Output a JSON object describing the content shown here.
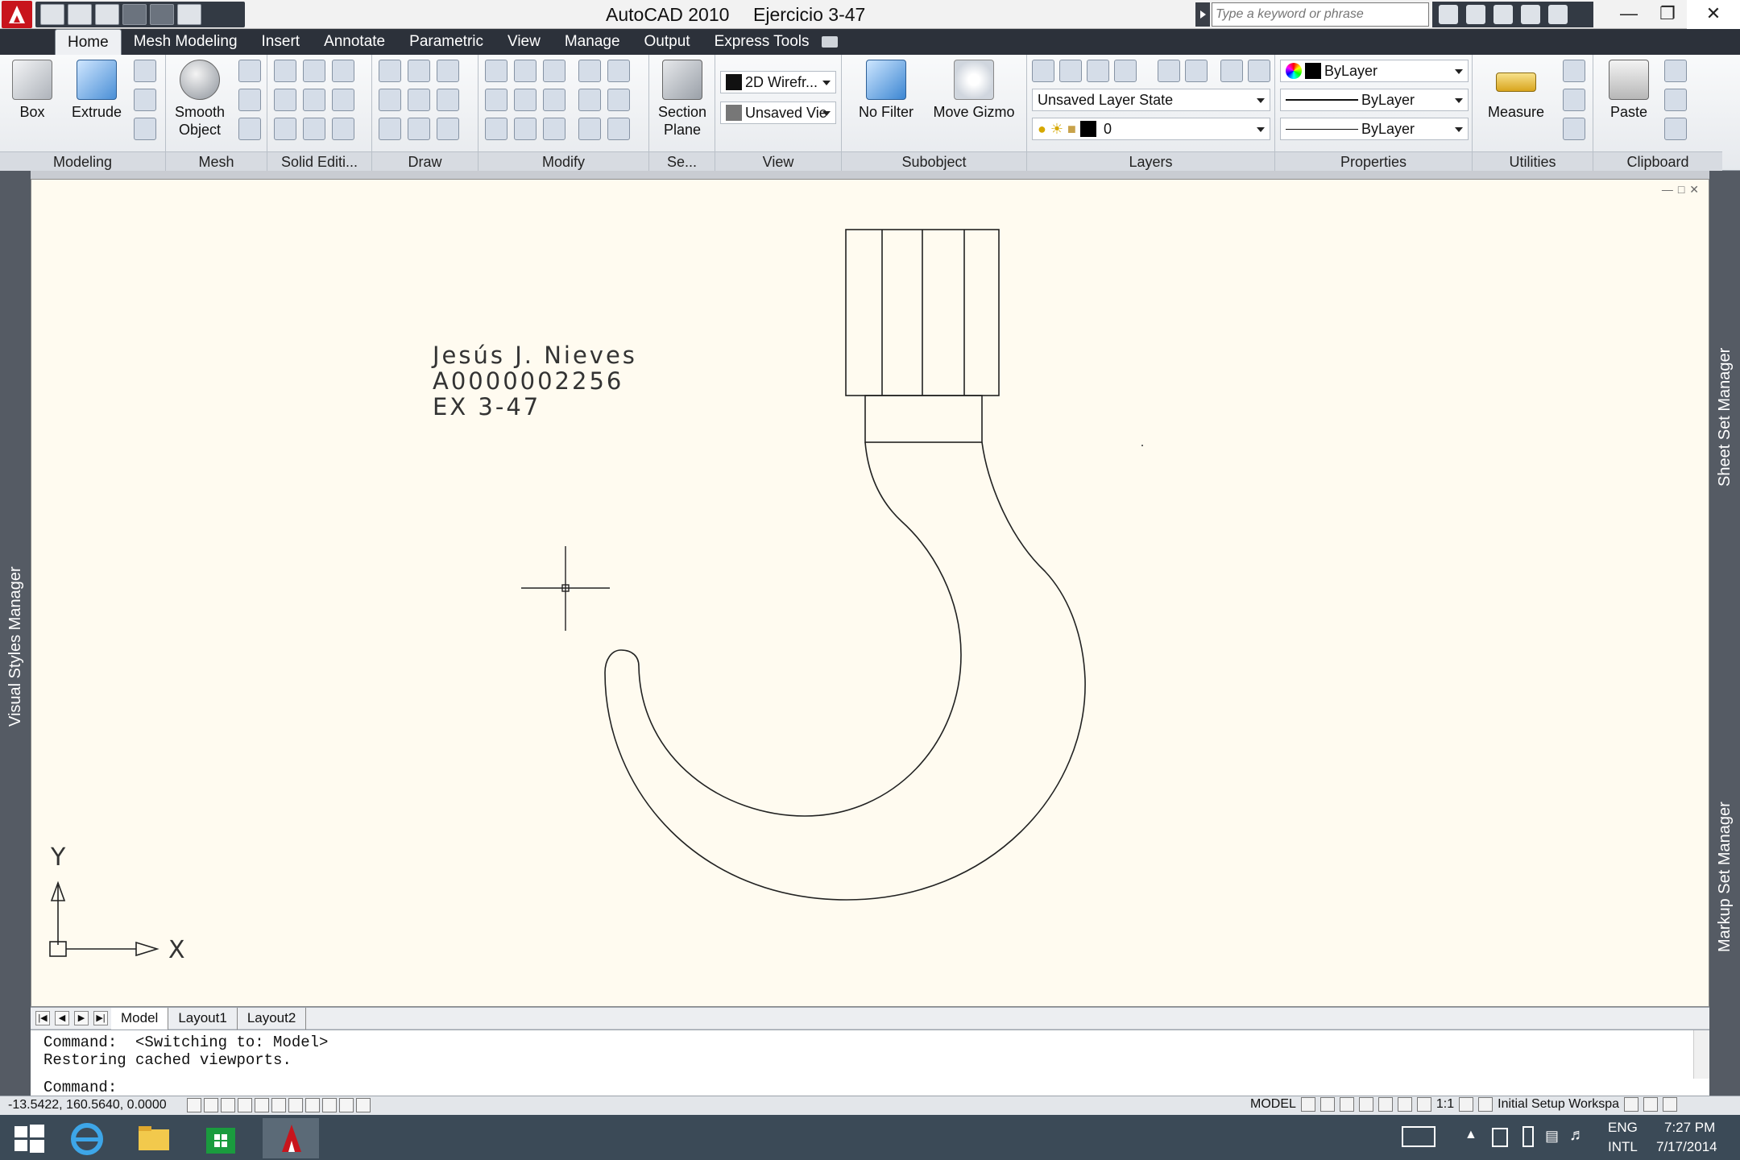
{
  "window": {
    "app_title": "AutoCAD 2010",
    "file_title": "Ejercicio 3-47",
    "search_placeholder": "Type a keyword or phrase"
  },
  "tabs": [
    "Home",
    "Mesh Modeling",
    "Insert",
    "Annotate",
    "Parametric",
    "View",
    "Manage",
    "Output",
    "Express Tools"
  ],
  "active_tab": "Home",
  "ribbon": {
    "modeling": {
      "title": "Modeling",
      "box": "Box",
      "extrude": "Extrude"
    },
    "mesh": {
      "title": "Mesh",
      "smooth_line1": "Smooth",
      "smooth_line2": "Object"
    },
    "solid_editing": {
      "title": "Solid Editi..."
    },
    "draw": {
      "title": "Draw"
    },
    "modify": {
      "title": "Modify"
    },
    "section": {
      "title": "Se...",
      "btn_line1": "Section",
      "btn_line2": "Plane"
    },
    "view": {
      "title": "View",
      "visual_style": "2D Wirefr...",
      "saved_view": "Unsaved Vie"
    },
    "subobject": {
      "title": "Subobject",
      "no_filter": "No Filter",
      "move_gizmo": "Move Gizmo"
    },
    "layers": {
      "title": "Layers",
      "layer_state": "Unsaved Layer State",
      "current_layer": "0"
    },
    "properties": {
      "title": "Properties",
      "color": "ByLayer",
      "lineweight": "ByLayer",
      "linetype": "ByLayer"
    },
    "utilities": {
      "title": "Utilities",
      "measure": "Measure"
    },
    "clipboard": {
      "title": "Clipboard",
      "paste": "Paste"
    }
  },
  "palettes": {
    "left": "Visual Styles Manager",
    "right_top": "Sheet Set Manager",
    "right_bottom": "Markup Set Manager"
  },
  "drawing": {
    "text_line1": "Jesús J. Nieves",
    "text_line2": "A0000002256",
    "text_line3": "EX 3-47",
    "ucs_y": "Y",
    "ucs_x": "X"
  },
  "layout_tabs": [
    "Model",
    "Layout1",
    "Layout2"
  ],
  "active_layout": "Model",
  "command": {
    "line1": "Command:  <Switching to: Model>",
    "line2": "Restoring cached viewports.",
    "prompt": "Command:"
  },
  "status": {
    "coordinates": "-13.5422, 160.5640, 0.0000",
    "space": "MODEL",
    "annotation_scale": "1:1",
    "workspace": "Initial Setup Workspa"
  },
  "tray": {
    "language": "ENG",
    "layout": "INTL",
    "time": "7:27 PM",
    "date": "7/17/2014"
  }
}
